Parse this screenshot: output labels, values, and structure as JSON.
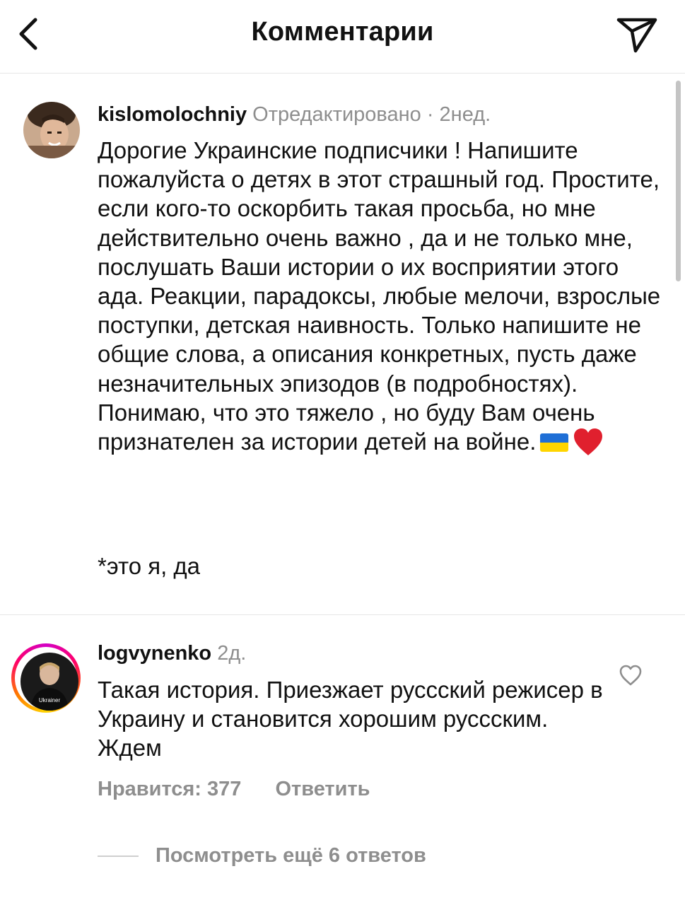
{
  "header": {
    "title": "Комментарии"
  },
  "comments": [
    {
      "username": "kislomolochniy",
      "meta": "Отредактировано · 2нед.",
      "text": "Дорогие Украинские подписчики ! Напишите пожалуйста о детях в этот страшный год. Простите, если кого-то оскорбить такая просьба, но мне действительно очень важно , да и не только мне, послушать Ваши истории о их восприятии этого ада. Реакции, парадоксы, любые мелочи, взрослые поступки, детская наивность. Только напишите не общие слова, а описания конкретных, пусть даже незначительных эпизодов (в подробностях). Понимаю, что это тяжело , но буду Вам очень признателен за истории детей на войне.",
      "emojis": [
        "ukraine-flag",
        "red-heart"
      ],
      "note": "*это я, да"
    },
    {
      "username": "logvynenko",
      "meta": "2д.",
      "text": "Такая история. Приезжает руссский режисер в Украину и становится хорошим руссским. Ждем",
      "likes_label": "Нравится: 377",
      "reply_label": "Ответить",
      "view_replies_label": "Посмотреть ещё 6 ответов",
      "avatar_badge": "Ukrainer"
    }
  ],
  "icons": {
    "back": "chevron-left-icon",
    "send": "paper-plane-icon",
    "like": "heart-outline-icon"
  },
  "colors": {
    "text": "#111111",
    "secondary": "#8e8e8e",
    "divider": "#e6e6e6"
  }
}
